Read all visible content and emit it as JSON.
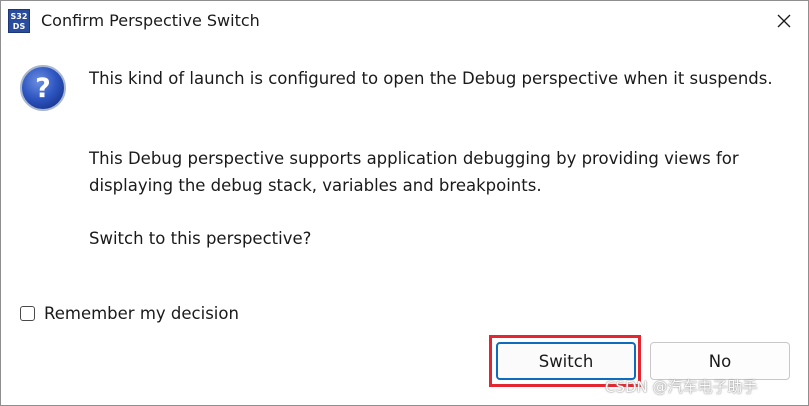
{
  "window": {
    "title": "Confirm Perspective Switch",
    "app_icon_lines": [
      "S32",
      "DS"
    ]
  },
  "dialog": {
    "message_1": "This kind of launch is configured to open the Debug perspective when it suspends.",
    "message_2": "This Debug perspective supports application debugging by providing views for displaying the debug stack, variables and breakpoints.",
    "message_3": "Switch to this perspective?",
    "remember_label": "Remember my decision",
    "remember_checked": false
  },
  "buttons": {
    "switch_label": "Switch",
    "no_label": "No"
  },
  "watermark": "CSDN @汽车电子助手",
  "colors": {
    "highlight": "#e3262f",
    "default_button_border": "#0f6cbd",
    "icon_blue": "#2a4c9c"
  },
  "icons": [
    "s32ds-app-icon",
    "close-icon",
    "question-icon"
  ]
}
